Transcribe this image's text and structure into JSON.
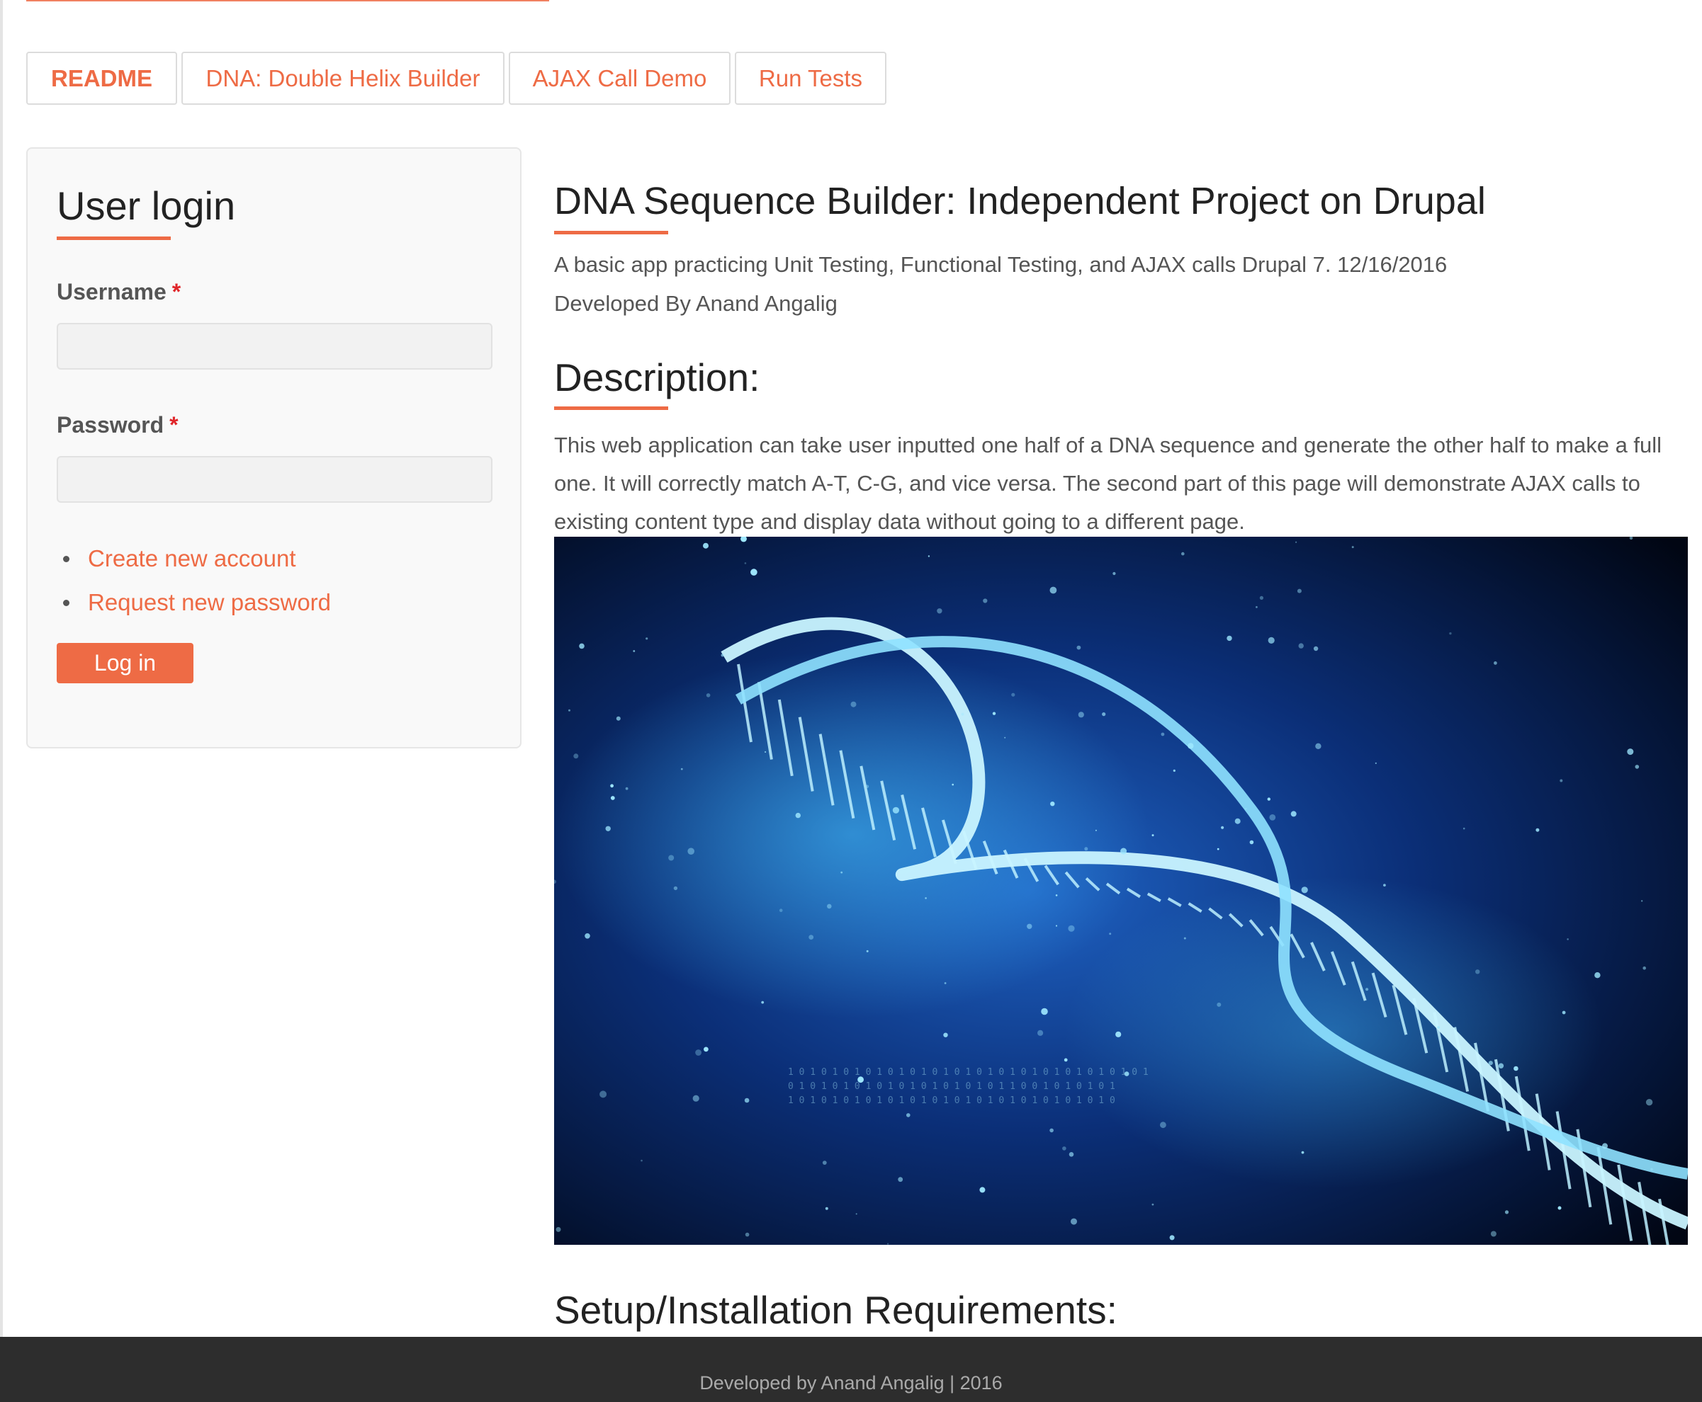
{
  "tabs": [
    {
      "label": "README",
      "active": true
    },
    {
      "label": "DNA: Double Helix Builder",
      "active": false
    },
    {
      "label": "AJAX Call Demo",
      "active": false
    },
    {
      "label": "Run Tests",
      "active": false
    }
  ],
  "login": {
    "title": "User login",
    "username_label": "Username",
    "password_label": "Password",
    "required_mark": "*",
    "links": [
      "Create new account",
      "Request new password"
    ],
    "submit_label": "Log in"
  },
  "content": {
    "title": "DNA Sequence Builder: Independent Project on Drupal",
    "subtitle": "A basic app practicing Unit Testing, Functional Testing, and AJAX calls Drupal 7. 12/16/2016",
    "author": "Developed By Anand Angalig",
    "description_heading": "Description:",
    "description_text": "This web application can take user inputted one half of a DNA sequence and generate the other half to make a full one. It will correctly match A-T, C-G, and vice versa. The second part of this page will demonstrate AJAX calls to existing content type and display data without going to a different page.",
    "setup_heading": "Setup/Installation Requirements:"
  },
  "footer": {
    "text": "Developed by Anand Angalig | 2016"
  },
  "colors": {
    "accent": "#ee6b45",
    "footer_bg": "#2d2d2d",
    "required": "#e0262a"
  }
}
